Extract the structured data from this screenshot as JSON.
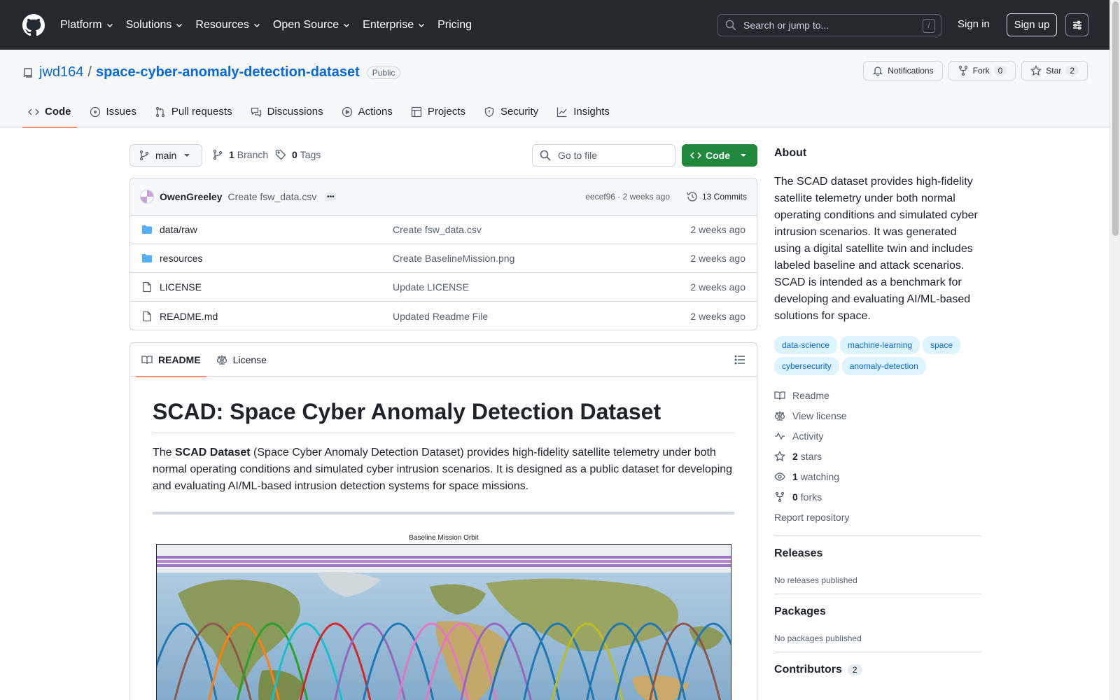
{
  "header": {
    "nav": [
      {
        "label": "Platform",
        "dropdown": true
      },
      {
        "label": "Solutions",
        "dropdown": true
      },
      {
        "label": "Resources",
        "dropdown": true
      },
      {
        "label": "Open Source",
        "dropdown": true
      },
      {
        "label": "Enterprise",
        "dropdown": true
      },
      {
        "label": "Pricing",
        "dropdown": false
      }
    ],
    "search_placeholder": "Search or jump to...",
    "search_shortcut": "/",
    "sign_in": "Sign in",
    "sign_up": "Sign up"
  },
  "repo": {
    "owner": "jwd164",
    "separator": "/",
    "name": "space-cyber-anomaly-detection-dataset",
    "visibility": "Public",
    "notifications_label": "Notifications",
    "fork_label": "Fork",
    "fork_count": "0",
    "star_label": "Star",
    "star_count": "2",
    "tabs": [
      {
        "label": "Code",
        "icon": "code-icon",
        "active": true
      },
      {
        "label": "Issues",
        "icon": "issue-icon",
        "active": false
      },
      {
        "label": "Pull requests",
        "icon": "pull-request-icon",
        "active": false
      },
      {
        "label": "Discussions",
        "icon": "discussion-icon",
        "active": false
      },
      {
        "label": "Actions",
        "icon": "play-icon",
        "active": false
      },
      {
        "label": "Projects",
        "icon": "table-icon",
        "active": false
      },
      {
        "label": "Security",
        "icon": "shield-icon",
        "active": false
      },
      {
        "label": "Insights",
        "icon": "graph-icon",
        "active": false
      }
    ]
  },
  "files": {
    "branch": "main",
    "branch_count": "1",
    "branch_label": "Branch",
    "tag_count": "0",
    "tag_label": "Tags",
    "goto_placeholder": "Go to file",
    "code_button": "Code",
    "latest_commit": {
      "author": "OwenGreeley",
      "message": "Create fsw_data.csv",
      "hash_time": "eecef96 · 2 weeks ago",
      "commits": "13 Commits"
    },
    "rows": [
      {
        "name": "data/raw",
        "type": "folder",
        "message": "Create fsw_data.csv",
        "time": "2 weeks ago"
      },
      {
        "name": "resources",
        "type": "folder",
        "message": "Create BaselineMission.png",
        "time": "2 weeks ago"
      },
      {
        "name": "LICENSE",
        "type": "file",
        "message": "Update LICENSE",
        "time": "2 weeks ago"
      },
      {
        "name": "README.md",
        "type": "file",
        "message": "Updated Readme File",
        "time": "2 weeks ago"
      }
    ]
  },
  "readme": {
    "tab_readme": "README",
    "tab_license": "License",
    "title": "SCAD: Space Cyber Anomaly Detection Dataset",
    "intro_prefix": "The ",
    "intro_bold": "SCAD Dataset",
    "intro_rest": " (Space Cyber Anomaly Detection Dataset) provides high-fidelity satellite telemetry under both normal operating conditions and simulated cyber intrusion scenarios. It is designed as a public dataset for developing and evaluating AI/ML-based intrusion detection systems for space missions.",
    "figure_title": "Baseline Mission Orbit"
  },
  "sidebar": {
    "about_heading": "About",
    "description": "The SCAD dataset provides high-fidelity satellite telemetry under both normal operating conditions and simulated cyber intrusion scenarios. It was generated using a digital satellite twin and includes labeled baseline and attack scenarios. SCAD is intended as a benchmark for developing and evaluating AI/ML-based solutions for space.",
    "topics": [
      "data-science",
      "machine-learning",
      "space",
      "cybersecurity",
      "anomaly-detection"
    ],
    "links": [
      {
        "icon": "book-icon",
        "bold": "",
        "label": "Readme"
      },
      {
        "icon": "law-icon",
        "bold": "",
        "label": "View license"
      },
      {
        "icon": "pulse-icon",
        "bold": "",
        "label": "Activity"
      },
      {
        "icon": "star-icon",
        "bold": "2",
        "label": "stars"
      },
      {
        "icon": "eye-icon",
        "bold": "1",
        "label": "watching"
      },
      {
        "icon": "fork-icon",
        "bold": "0",
        "label": "forks"
      }
    ],
    "report": "Report repository",
    "releases_heading": "Releases",
    "releases_empty": "No releases published",
    "packages_heading": "Packages",
    "packages_empty": "No packages published",
    "contributors_heading": "Contributors",
    "contributors_count": "2"
  },
  "colors": {
    "header_bg": "#24292f",
    "link": "#0969da",
    "primary_button": "#1f883d",
    "active_tab_underline": "#fd8c73",
    "topic_bg": "#ddf4ff"
  }
}
